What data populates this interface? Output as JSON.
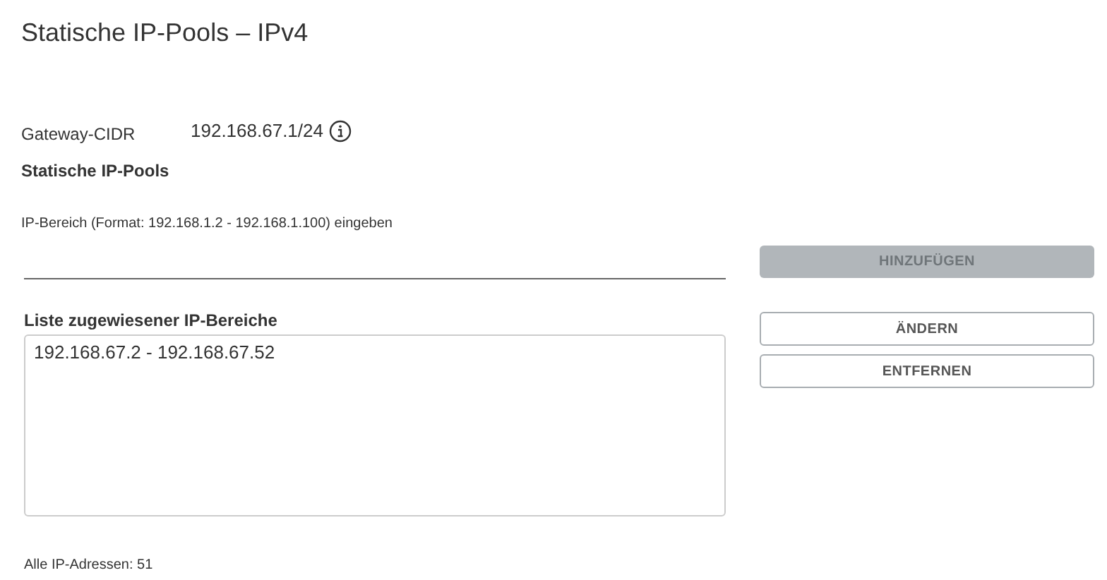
{
  "title": "Statische IP-Pools – IPv4",
  "gateway": {
    "label": "Gateway-CIDR",
    "value": "192.168.67.1/24"
  },
  "section_title": "Statische IP-Pools",
  "range_field": {
    "label": "IP-Bereich (Format: 192.168.1.2 - 192.168.1.100) eingeben"
  },
  "add_button": {
    "label": "HINZUFÜGEN",
    "disabled": true
  },
  "list": {
    "label": "Liste zugewiesener IP-Bereiche",
    "items": [
      {
        "text": "192.168.67.2 - 192.168.67.52"
      }
    ]
  },
  "buttons": [
    {
      "label": "ÄNDERN",
      "disabled": false
    },
    {
      "label": "ENTFERNEN",
      "disabled": false
    }
  ],
  "footer": "Alle IP-Adressen: 51"
}
